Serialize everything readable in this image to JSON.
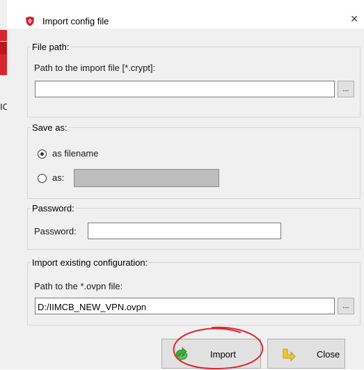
{
  "background": {
    "partial_text": "IC"
  },
  "window": {
    "title": "Import config file",
    "close_glyph": "×"
  },
  "file_path": {
    "group_label": "File path:",
    "field_label": "Path to the import file [*.crypt]:",
    "value": "",
    "browse_label": "..."
  },
  "save_as": {
    "group_label": "Save as:",
    "option_filename_label": "as filename",
    "option_as_label": "as:",
    "selected": "as filename",
    "as_value": ""
  },
  "password": {
    "group_label": "Password:",
    "field_label": "Password:",
    "value": ""
  },
  "import_existing": {
    "group_label": "Import existing configuration:",
    "field_label": "Path to the *.ovpn file:",
    "value": "D:/IIMCB_NEW_VPN.ovpn",
    "browse_label": "..."
  },
  "buttons": {
    "import_label": "Import",
    "close_label": "Close"
  },
  "icons": {
    "title_icon": "shield-icon",
    "import_icon": "green-arrows-icon",
    "close_icon": "yellow-arrow-icon"
  },
  "colors": {
    "annotation_circle": "#e0242a",
    "disabled_field": "#bdbdbd"
  }
}
